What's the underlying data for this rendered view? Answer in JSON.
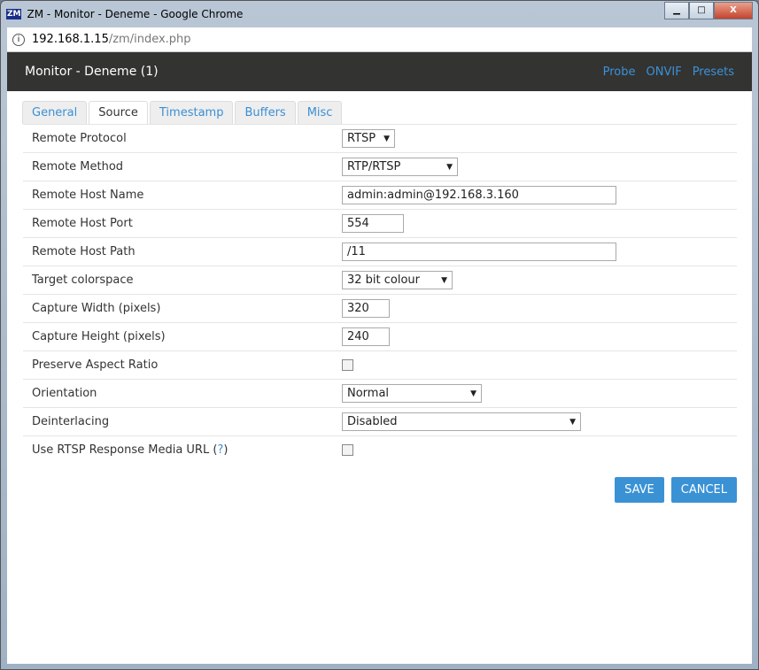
{
  "window": {
    "title": "ZM - Monitor - Deneme - Google Chrome",
    "logo": "ZM"
  },
  "address": {
    "host": "192.168.1.15",
    "path": "/zm/index.php"
  },
  "header": {
    "title": "Monitor - Deneme (1)",
    "links": [
      "Probe",
      "ONVIF",
      "Presets"
    ]
  },
  "tabs": [
    "General",
    "Source",
    "Timestamp",
    "Buffers",
    "Misc"
  ],
  "active_tab": "Source",
  "rows": [
    {
      "label": "Remote Protocol",
      "type": "select",
      "value": "RTSP"
    },
    {
      "label": "Remote Method",
      "type": "select",
      "value": "RTP/RTSP"
    },
    {
      "label": "Remote Host Name",
      "type": "text",
      "value": "admin:admin@192.168.3.160"
    },
    {
      "label": "Remote Host Port",
      "type": "text",
      "value": "554"
    },
    {
      "label": "Remote Host Path",
      "type": "text",
      "value": "/11"
    },
    {
      "label": "Target colorspace",
      "type": "select",
      "value": "32 bit colour"
    },
    {
      "label": "Capture Width (pixels)",
      "type": "text",
      "value": "320"
    },
    {
      "label": "Capture Height (pixels)",
      "type": "text",
      "value": "240"
    },
    {
      "label": "Preserve Aspect Ratio",
      "type": "checkbox",
      "checked": false
    },
    {
      "label": "Orientation",
      "type": "select",
      "value": "Normal"
    },
    {
      "label": "Deinterlacing",
      "type": "select",
      "value": "Disabled"
    },
    {
      "label": "Use RTSP Response Media URL",
      "help": "?",
      "type": "checkbox",
      "checked": false
    }
  ],
  "buttons": {
    "save": "SAVE",
    "cancel": "CANCEL"
  }
}
